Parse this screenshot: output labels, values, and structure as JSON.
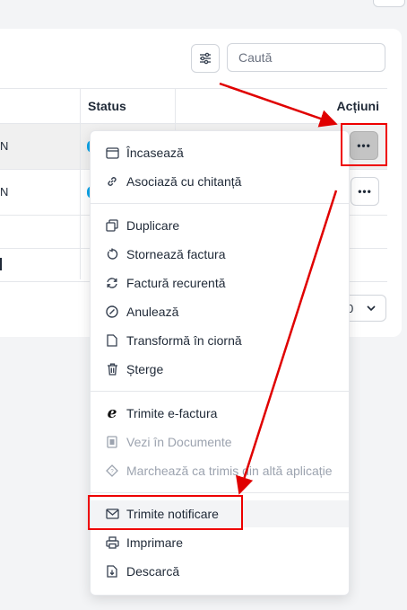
{
  "search": {
    "placeholder": "Caută"
  },
  "table": {
    "headers": {
      "status": "Status",
      "actions": "Acțiuni"
    },
    "rows": [
      {
        "left_text": "N"
      },
      {
        "left_text": "N"
      }
    ]
  },
  "pager": {
    "value": "0"
  },
  "context_menu": {
    "items": [
      {
        "label": "Încasează",
        "icon": "wallet-icon",
        "enabled": true
      },
      {
        "label": "Asociază cu chitanță",
        "icon": "link-icon",
        "enabled": true
      },
      {
        "label": "Duplicare",
        "icon": "copy-icon",
        "enabled": true
      },
      {
        "label": "Stornează factura",
        "icon": "undo-icon",
        "enabled": true
      },
      {
        "label": "Factură recurentă",
        "icon": "refresh-icon",
        "enabled": true
      },
      {
        "label": "Anulează",
        "icon": "cancel-icon",
        "enabled": true
      },
      {
        "label": "Transformă în ciornă",
        "icon": "file-icon",
        "enabled": true
      },
      {
        "label": "Șterge",
        "icon": "trash-icon",
        "enabled": true
      },
      {
        "label": "Trimite e-factura",
        "icon": "e-factura-icon",
        "enabled": true
      },
      {
        "label": "Vezi în Documente",
        "icon": "document-icon",
        "enabled": false
      },
      {
        "label": "Marchează ca trimis din altă aplicație",
        "icon": "tag-icon",
        "enabled": false
      },
      {
        "label": "Trimite notificare",
        "icon": "envelope-icon",
        "enabled": true
      },
      {
        "label": "Imprimare",
        "icon": "printer-icon",
        "enabled": true
      },
      {
        "label": "Descarcă",
        "icon": "download-icon",
        "enabled": true
      }
    ]
  },
  "colors": {
    "annotation": "#e00000",
    "status_accent": "#0ea5e9"
  }
}
